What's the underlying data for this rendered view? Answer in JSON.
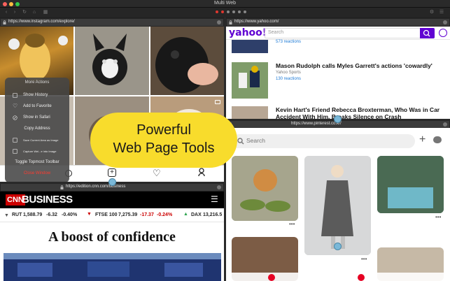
{
  "app": {
    "title": "Multi Web"
  },
  "panes": {
    "instagram": {
      "url": "https://www.instagram.com/explore/"
    },
    "yahoo": {
      "url": "https://www.yahoo.com/"
    },
    "pinterest": {
      "url": "https://www.pinterest.co.kr/"
    },
    "cnn": {
      "url": "https://edition.cnn.com/business"
    }
  },
  "menu": {
    "header": "More Actions",
    "items": [
      {
        "label": "Show History",
        "icon": "history-icon"
      },
      {
        "label": "Add to Favorite",
        "icon": "heart-icon"
      },
      {
        "label": "Show in Safari",
        "icon": "compass-icon"
      },
      {
        "label": "Copy Address",
        "icon": ""
      },
      {
        "label": "Save Current Area as Image",
        "icon": "image-icon"
      },
      {
        "label": "Capture Wel...e into Image",
        "icon": "image-icon"
      },
      {
        "label": "Toggle Topmost Toolbar",
        "icon": ""
      },
      {
        "label": "Close Window",
        "icon": ""
      }
    ]
  },
  "yahoo": {
    "logo": "yahoo!",
    "search_placeholder": "Search",
    "top_reactions": "573 reactions",
    "articles": [
      {
        "title": "Mason Rudolph calls Myles Garrett's actions 'cowardly'",
        "source": "Yahoo Sports",
        "reactions": "130 reactions"
      },
      {
        "title": "Kevin Hart's Friend Rebecca Broxterman, Who Was in Car Accident With Him, Breaks Silence on Crash"
      }
    ]
  },
  "pinterest": {
    "search_placeholder": "Search"
  },
  "cnn": {
    "logo": "CNN",
    "brand": "BUSINESS",
    "headline": "A boost of confidence",
    "tickers": [
      {
        "name": "RUT",
        "value": "1,588.79",
        "change": "-6.32",
        "pct": "-0.40%",
        "dir": "down"
      },
      {
        "name": "FTSE 100",
        "value": "7,275.39",
        "change": "-17.37",
        "pct": "-0.24%",
        "dir": "down"
      },
      {
        "name": "DAX",
        "value": "13,216.5",
        "dir": "up"
      }
    ]
  },
  "promo": {
    "line1": "Powerful",
    "line2": "Web Page Tools"
  },
  "colors": {
    "accent_yellow": "#f8dc2c",
    "yahoo_purple": "#6001d2",
    "cnn_red": "#cc0000",
    "pinterest_red": "#e60023",
    "link_blue": "#1d7ad6"
  }
}
